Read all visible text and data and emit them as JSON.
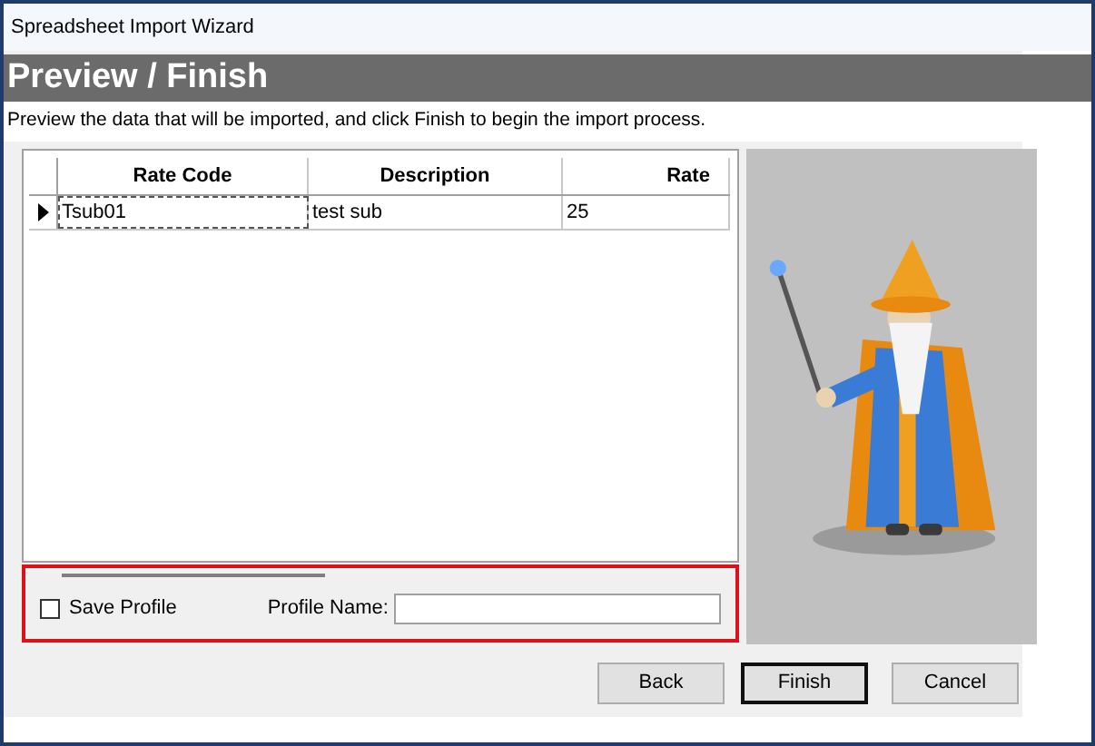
{
  "window": {
    "title": "Spreadsheet Import Wizard"
  },
  "header": {
    "title": "Preview / Finish"
  },
  "instructions": "Preview the data that will be imported, and click Finish to begin the import process.",
  "table": {
    "columns": [
      "Rate Code",
      "Description",
      "Rate"
    ],
    "rows": [
      {
        "cells": [
          "Tsub01",
          "test sub",
          "25"
        ],
        "selected": true
      }
    ]
  },
  "save_profile": {
    "label": "Save Profile",
    "checked": false
  },
  "profile_name": {
    "label": "Profile Name:"
  },
  "buttons": [
    {
      "label": "Back",
      "default": false
    },
    {
      "label": "Finish",
      "default": true
    },
    {
      "label": "Cancel",
      "default": false
    }
  ]
}
